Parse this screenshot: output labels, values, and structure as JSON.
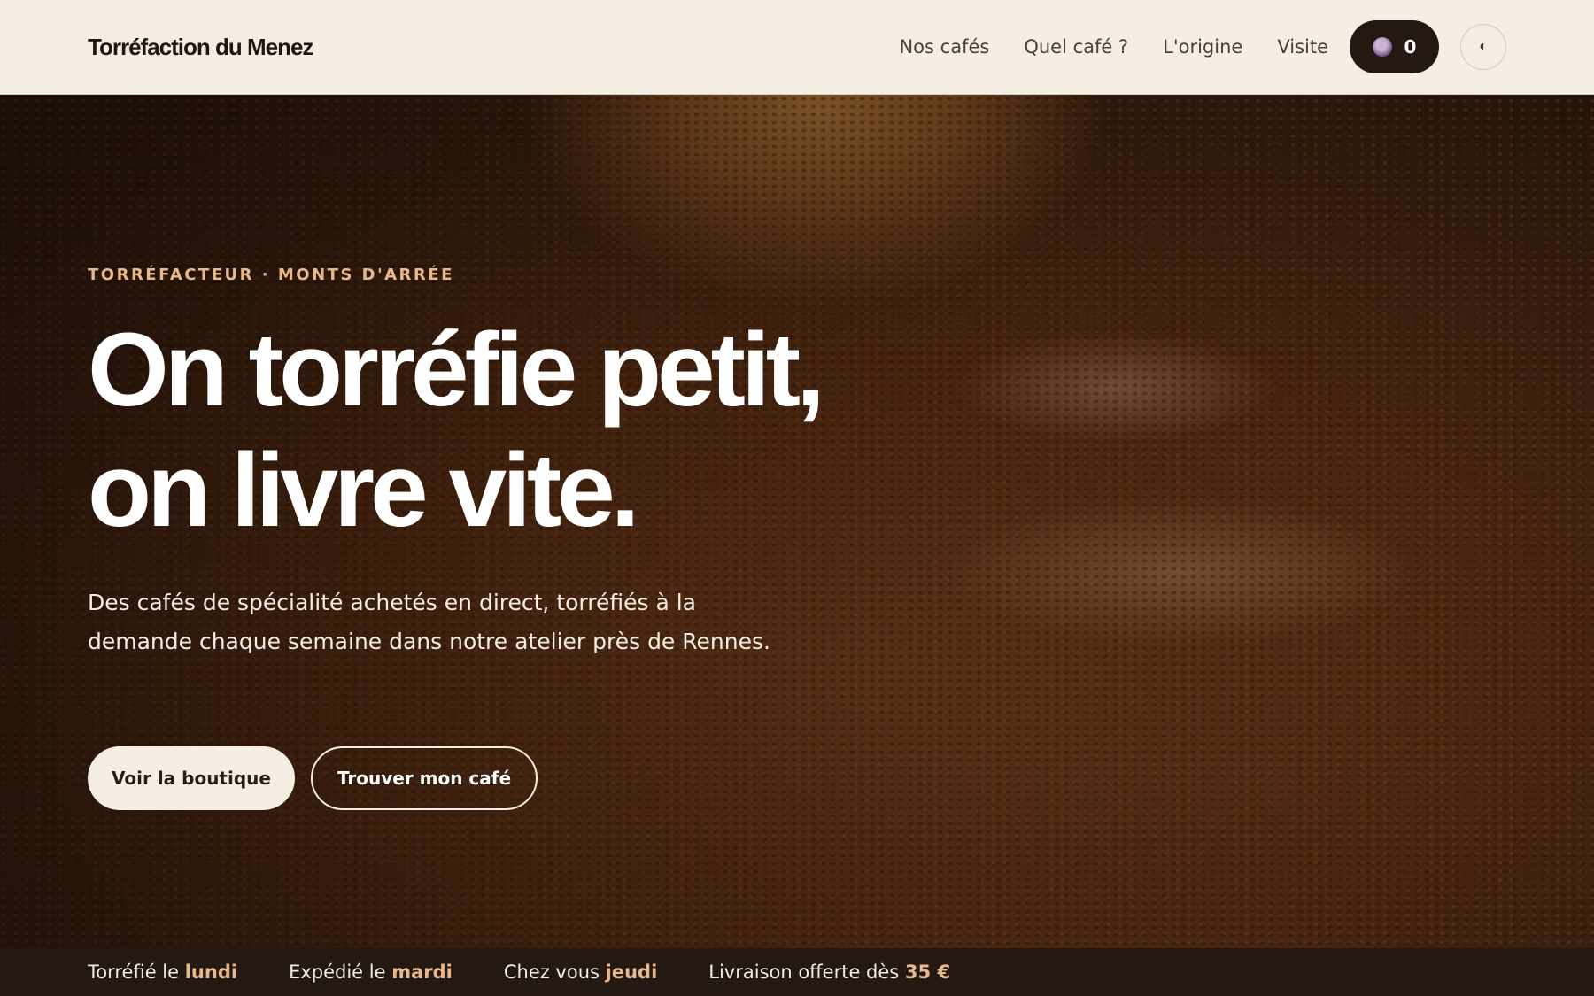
{
  "header": {
    "brand": "Torréfaction du Menez",
    "nav": [
      {
        "label": "Nos cafés"
      },
      {
        "label": "Quel café ?"
      },
      {
        "label": "L'origine"
      },
      {
        "label": "Visite"
      }
    ],
    "cart_count": "0",
    "cart_icon": "coffee-cup-icon",
    "theme_icon": "contrast-toggle-icon",
    "theme_glyph": "◐"
  },
  "hero": {
    "eyebrow": "TORRÉFACTEUR · MONTS D'ARRÉE",
    "headline_line1": "On torréfie petit,",
    "headline_line2": "on livre vite.",
    "lead": "Des cafés de spécialité achetés en direct, torréfiés à la demande chaque semaine dans notre atelier près de Rennes.",
    "cta_primary": "Voir la boutique",
    "cta_secondary": "Trouver mon café",
    "background_image": "coffee roaster drum with beans"
  },
  "ticker": {
    "items": [
      {
        "text": "Torréfié le ",
        "highlight": "lundi"
      },
      {
        "text": "Expédié le ",
        "highlight": "mardi"
      },
      {
        "text": "Chez vous ",
        "highlight": "jeudi"
      },
      {
        "text": "Livraison offerte dès ",
        "highlight": "35 €"
      }
    ]
  },
  "colors": {
    "cream": "#f5eee2",
    "dark": "#231812",
    "accent": "#e7b98d"
  }
}
